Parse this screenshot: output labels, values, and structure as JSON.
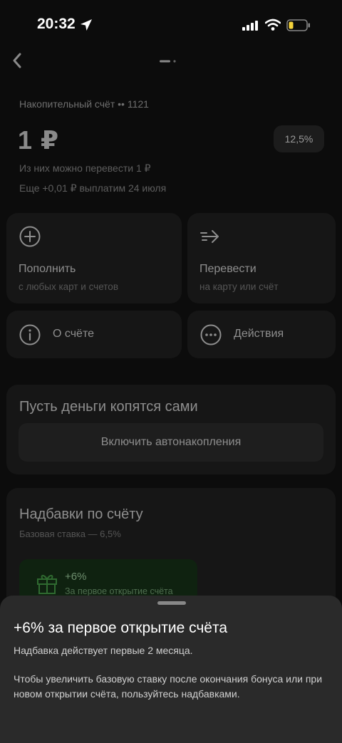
{
  "status": {
    "time": "20:32"
  },
  "account": {
    "title": "Накопительный счёт •• 1121",
    "balance": "1 ₽",
    "rate": "12,5%",
    "available": "Из них можно перевести 1 ₽",
    "extra": "Еще +0,01 ₽ выплатим 24 июля"
  },
  "actions": {
    "topup": {
      "label": "Пополнить",
      "sub": "с любых карт и счетов",
      "icon": "plus-circle-icon"
    },
    "transfer": {
      "label": "Перевести",
      "sub": "на карту или счёт",
      "icon": "arrow-right-icon"
    },
    "about": {
      "label": "О счёте",
      "icon": "info-icon"
    },
    "more": {
      "label": "Действия",
      "icon": "more-dots-icon"
    }
  },
  "autosave": {
    "title": "Пусть деньги копятся сами",
    "button": "Включить автонакопления"
  },
  "bonuses": {
    "title": "Надбавки по счёту",
    "base": "Базовая ставка — 6,5%",
    "chip": {
      "value": "+6%",
      "sub": "За первое открытие счёта",
      "icon": "gift-icon"
    }
  },
  "sheet": {
    "title": "+6% за первое открытие счёта",
    "text1": "Надбавка действует первые 2 месяца.",
    "text2": "Чтобы увеличить базовую ставку после окончания бонуса или при новом открытии счёта, пользуйтесь надбавками."
  },
  "colors": {
    "accent_green": "#1f8a3a",
    "sheet_bg": "#2a2a2a",
    "card_bg": "#161616"
  }
}
